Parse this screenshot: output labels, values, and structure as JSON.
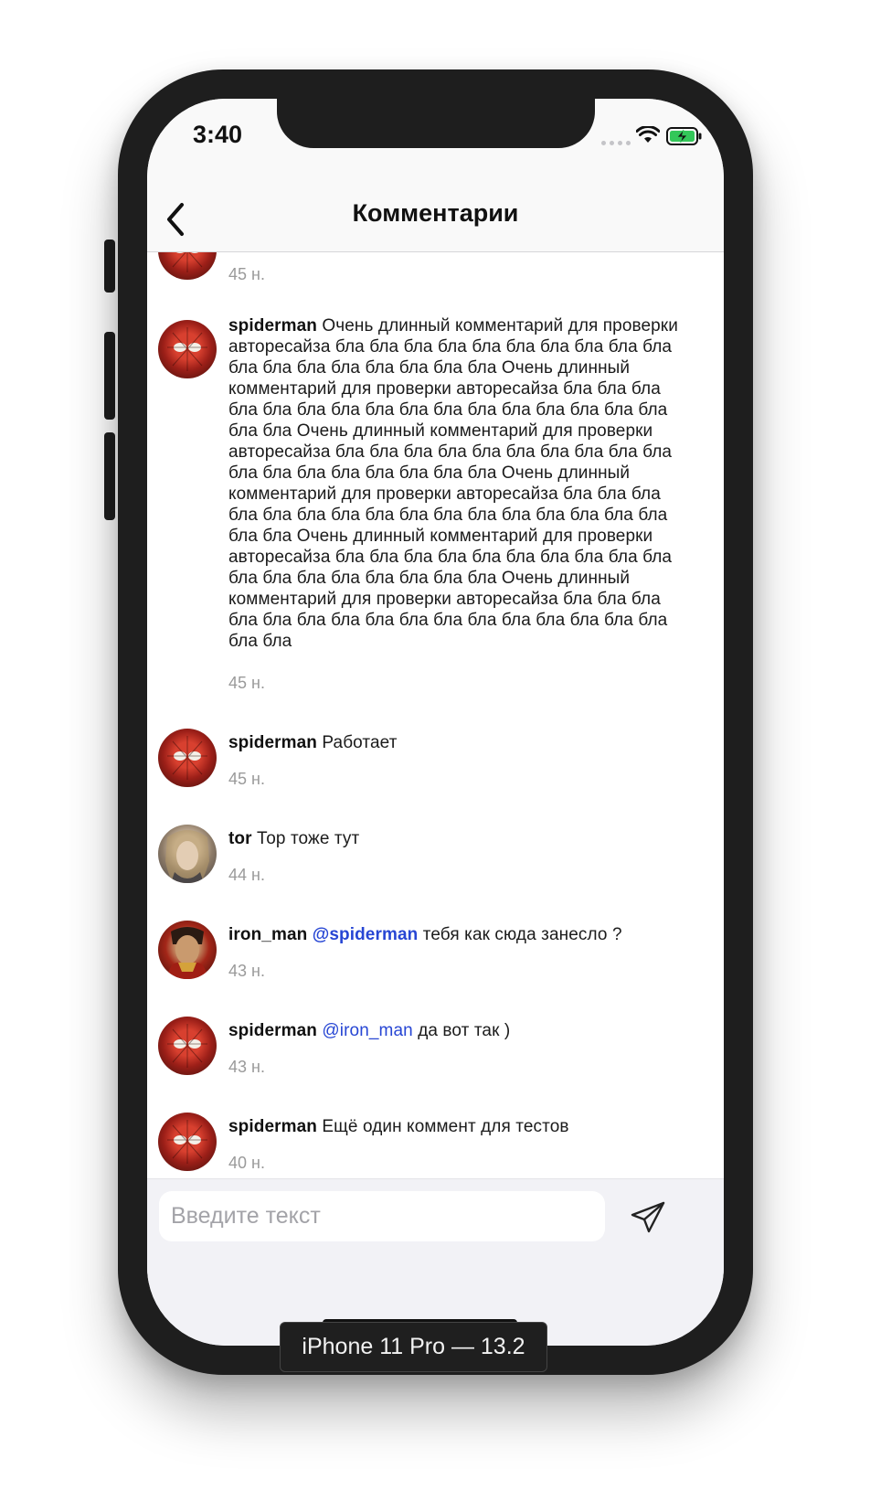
{
  "status_bar": {
    "time": "3:40"
  },
  "nav": {
    "title": "Комментарии",
    "back_icon": "chevron-left-icon"
  },
  "comments": [
    {
      "user": "",
      "text": "",
      "time": "45 н.",
      "avatar": "spiderman-avatar"
    },
    {
      "user": "spiderman",
      "text": "Очень длинный комментарий для проверки авторесайза бла бла бла бла бла бла бла бла бла бла бла бла бла бла бла бла бла бла Очень длинный комментарий для проверки авторесайза бла бла бла бла бла бла бла бла бла бла бла бла бла бла бла бла бла бла Очень длинный комментарий для проверки авторесайза бла бла бла бла бла бла бла бла бла бла бла бла бла бла бла бла бла бла Очень длинный комментарий для проверки авторесайза бла бла бла бла бла бла бла бла бла бла бла бла бла бла бла бла бла бла Очень длинный комментарий для проверки авторесайза бла бла бла бла бла бла бла бла бла бла бла бла бла бла бла бла бла бла Очень длинный комментарий для проверки авторесайза бла бла бла бла бла бла бла бла бла бла бла бла бла бла бла бла бла бла",
      "time": "45 н.",
      "avatar": "spiderman-avatar"
    },
    {
      "user": "spiderman",
      "text": "Работает",
      "time": "45 н.",
      "avatar": "spiderman-avatar"
    },
    {
      "user": "tor",
      "text": "Тор тоже тут",
      "time": "44 н.",
      "avatar": "tor-avatar"
    },
    {
      "user": "iron_man",
      "mention": "@spiderman",
      "text": "тебя как сюда занесло ?",
      "time": "43 н.",
      "avatar": "iron-man-avatar"
    },
    {
      "user": "spiderman",
      "mention": "@iron_man",
      "text": "да вот так )",
      "time": "43 н.",
      "avatar": "spiderman-avatar"
    },
    {
      "user": "spiderman",
      "text": "Ещё один коммент для тестов",
      "time": "40 н.",
      "avatar": "spiderman-avatar"
    }
  ],
  "input": {
    "placeholder": "Введите текст",
    "value": "",
    "send_icon": "paper-plane-icon"
  },
  "device_label": "iPhone 11 Pro — 13.2",
  "colors": {
    "mention": "#2746d4",
    "timestamp": "#9a9a9a",
    "navbar_bg": "#f9f9f9",
    "input_bar_bg": "#f2f2f6"
  }
}
